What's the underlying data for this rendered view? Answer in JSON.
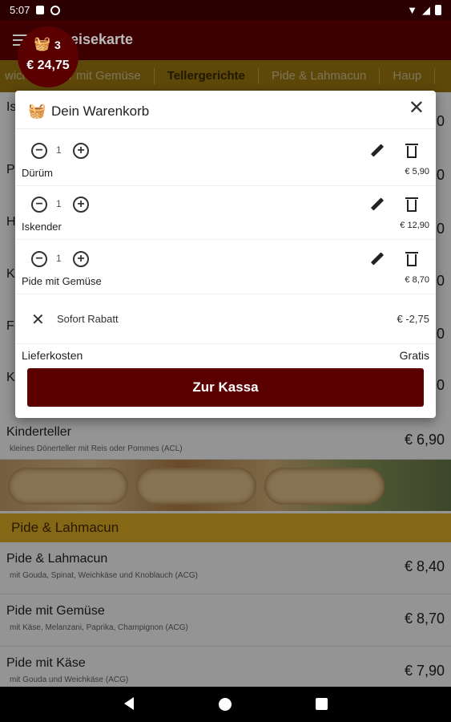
{
  "status": {
    "time": "5:07"
  },
  "appbar": {
    "title": "eisekarte"
  },
  "tabs": [
    "wich",
    "ner mit Gemüse",
    "Tellergerichte",
    "Pide & Lahmacun",
    "Haup"
  ],
  "cart_badge": {
    "count": "3",
    "total": "€ 24,75"
  },
  "background": {
    "letters": [
      "Is",
      "P",
      "H",
      "K",
      "F",
      "K"
    ],
    "side_prices": [
      "0",
      "0",
      "0",
      "0",
      "0",
      "0"
    ],
    "kinderteller": {
      "name": "Kinderteller",
      "desc": "kleines Dönerteller mit Reis oder Pommes (ACL)",
      "price": "€ 6,90"
    },
    "section": "Pide & Lahmacun",
    "items": [
      {
        "name": "Pide & Lahmacun",
        "desc": "mit Gouda, Spinat, Weichkäse und Knoblauch (ACG)",
        "price": "€ 8,40"
      },
      {
        "name": "Pide mit Gemüse",
        "desc": "mit Käse, Melanzani, Paprika, Champignon (ACG)",
        "price": "€ 8,70"
      },
      {
        "name": "Pide mit Käse",
        "desc": "mit Gouda und Weichkäse (ACG)",
        "price": "€ 7,90"
      }
    ]
  },
  "cart": {
    "title": "Dein Warenkorb",
    "items": [
      {
        "qty": "1",
        "name": "Dürüm",
        "price": "€ 5,90"
      },
      {
        "qty": "1",
        "name": "Iskender",
        "price": "€ 12,90"
      },
      {
        "qty": "1",
        "name": "Pide mit Gemüse",
        "price": "€ 8,70"
      }
    ],
    "discount": {
      "label": "Sofort Rabatt",
      "amount": "€ -2,75"
    },
    "delivery": {
      "label": "Lieferkosten",
      "value": "Gratis"
    },
    "checkout_label": "Zur Kassa"
  },
  "colors": {
    "primary": "#5a0000",
    "accent": "#e3b326",
    "appbar": "#3d0000"
  }
}
